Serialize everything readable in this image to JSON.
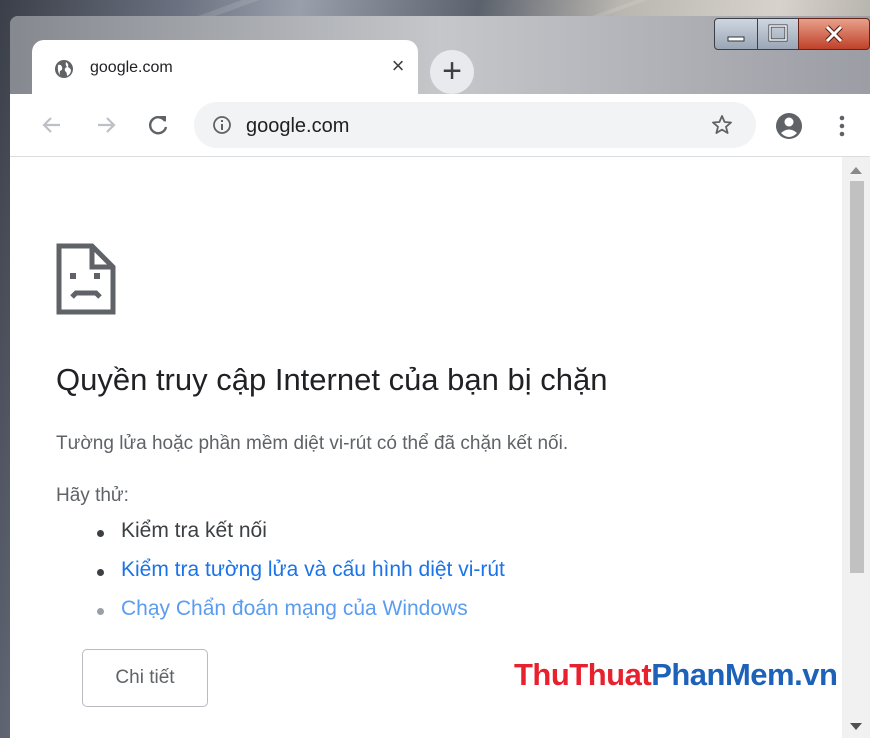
{
  "tab": {
    "title": "google.com",
    "close_glyph": "×",
    "favicon": "globe-icon"
  },
  "new_tab_glyph": "+",
  "window_controls": [
    "minimize",
    "maximize",
    "close"
  ],
  "toolbar": {
    "back_icon": "arrow-back-icon",
    "forward_icon": "arrow-forward-icon",
    "reload_icon": "reload-icon",
    "url": "google.com",
    "site_info_icon": "info-icon",
    "bookmark_icon": "star-icon",
    "profile_icon": "account-circle-icon",
    "menu_icon": "more-vert-icon"
  },
  "error_page": {
    "icon": "sad-page-icon",
    "heading": "Quyền truy cập Internet của bạn bị chặn",
    "description": "Tường lửa hoặc phần mềm diệt vi-rút có thể đã chặn kết nối.",
    "try_label": "Hãy thử:",
    "suggestions": [
      {
        "text": "Kiểm tra kết nối",
        "link": false
      },
      {
        "text": "Kiểm tra tường lửa và cấu hình diệt vi-rút",
        "link": true
      },
      {
        "text": "Chạy Chẩn đoán mạng của Windows",
        "link": true
      }
    ],
    "details_button": "Chi tiết"
  },
  "watermark": {
    "part1": "ThuThuat",
    "part2": "PhanMem.vn",
    "color1": "#e8212e",
    "color2": "#1d62b8"
  },
  "colors": {
    "link": "#1a73e8",
    "heading": "#202124",
    "body_text": "#5f6368"
  }
}
